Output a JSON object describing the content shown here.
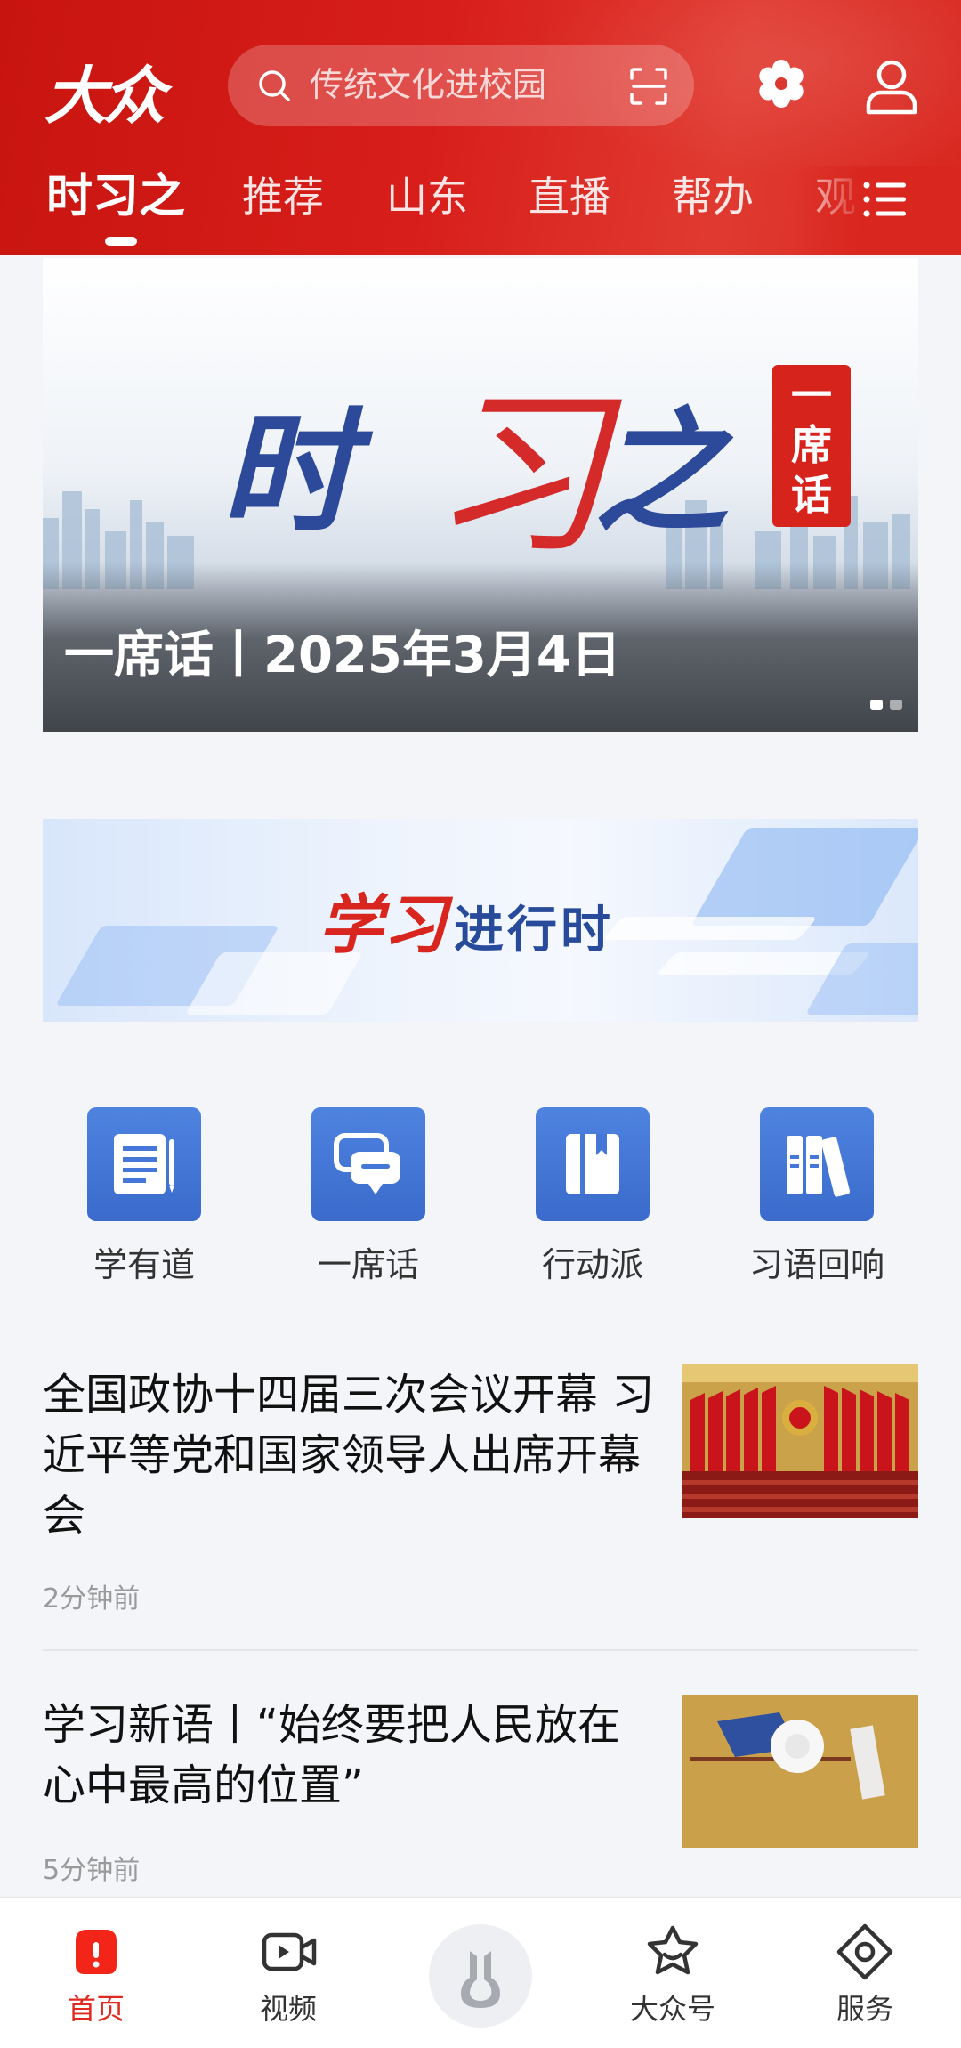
{
  "header": {
    "logo_text": "大众",
    "search_placeholder": "传统文化进校园",
    "tabs": [
      "时习之",
      "推荐",
      "山东",
      "直播",
      "帮办",
      "观"
    ]
  },
  "banner": {
    "title_parts": [
      "时",
      "习",
      "之"
    ],
    "seal_text": "一席话",
    "caption": "一席话丨2025年3月4日"
  },
  "promo": {
    "part1": "学习",
    "part2": "进行时"
  },
  "shortcuts": [
    {
      "label": "学有道",
      "icon": "document-icon"
    },
    {
      "label": "一席话",
      "icon": "chat-icon"
    },
    {
      "label": "行动派",
      "icon": "book-icon"
    },
    {
      "label": "习语回响",
      "icon": "binders-icon"
    }
  ],
  "news": [
    {
      "title": "全国政协十四届三次会议开幕 习近平等党和国家领导人出席开幕会",
      "time": "2分钟前"
    },
    {
      "title": "学习新语丨“始终要把人民放在心中最高的位置”",
      "time": "5分钟前"
    }
  ],
  "bottom_nav": [
    {
      "label": "首页",
      "icon": "home-icon",
      "active": true
    },
    {
      "label": "视频",
      "icon": "video-icon",
      "active": false
    },
    {
      "label": "",
      "icon": "center-logo-icon",
      "active": false
    },
    {
      "label": "大众号",
      "icon": "star-icon",
      "active": false
    },
    {
      "label": "服务",
      "icon": "service-icon",
      "active": false
    }
  ],
  "colors": {
    "brand_red": "#d81e1a",
    "shortcut_blue": "#3f72d6",
    "active_nav": "#e02a20"
  }
}
